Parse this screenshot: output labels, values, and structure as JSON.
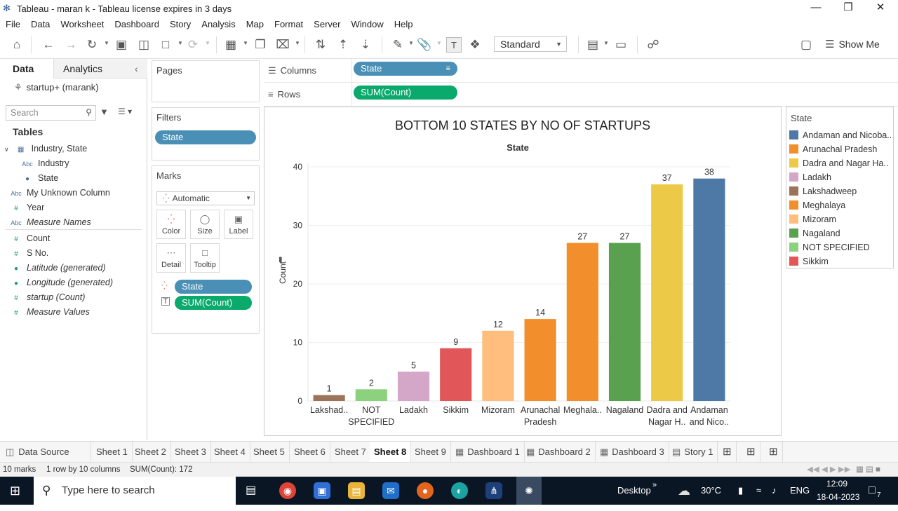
{
  "window": {
    "title": "Tableau - maran k - Tableau license expires in 3 days"
  },
  "menu": [
    "File",
    "Data",
    "Worksheet",
    "Dashboard",
    "Story",
    "Analysis",
    "Map",
    "Format",
    "Server",
    "Window",
    "Help"
  ],
  "toolbar": {
    "fit_value": "Standard",
    "show_me_label": "Show Me"
  },
  "datapane": {
    "tab_data": "Data",
    "tab_analytics": "Analytics",
    "datasource": "startup+ (marank)",
    "search_placeholder": "Search",
    "tables_heading": "Tables",
    "table_group": "Industry, State",
    "fields": [
      {
        "label": "Industry",
        "icon": "abc"
      },
      {
        "label": "State",
        "icon": "globe"
      },
      {
        "label": "My Unknown Column",
        "icon": "abc"
      },
      {
        "label": "Year",
        "icon": "hash"
      },
      {
        "label": "Measure Names",
        "icon": "abc"
      },
      {
        "label": "Count",
        "icon": "hash"
      },
      {
        "label": "S No.",
        "icon": "hash"
      },
      {
        "label": "Latitude (generated)",
        "icon": "globe"
      },
      {
        "label": "Longitude (generated)",
        "icon": "globe"
      },
      {
        "label": "startup (Count)",
        "icon": "hash"
      },
      {
        "label": "Measure Values",
        "icon": "hash"
      }
    ]
  },
  "pages": {
    "title": "Pages"
  },
  "filters": {
    "title": "Filters",
    "pill": "State"
  },
  "marks": {
    "title": "Marks",
    "type": "Automatic",
    "buttons": [
      "Color",
      "Size",
      "Label",
      "Detail",
      "Tooltip"
    ],
    "pill_state": "State",
    "pill_count": "SUM(Count)"
  },
  "shelves": {
    "columns_label": "Columns",
    "columns_pill": "State",
    "rows_label": "Rows",
    "rows_pill": "SUM(Count)"
  },
  "chart_data": {
    "type": "bar",
    "title": "BOTTOM 10 STATES BY NO OF STARTUPS",
    "subtitle": "State",
    "ylabel": "Count",
    "ylim": [
      0,
      40
    ],
    "yticks": [
      0,
      10,
      20,
      30,
      40
    ],
    "grid": true,
    "categories": [
      "Lakshad..",
      "NOT SPECIFIED",
      "Ladakh",
      "Sikkim",
      "Mizoram",
      "Arunachal Pradesh",
      "Meghala..",
      "Nagaland",
      "Dadra and Nagar H..",
      "Andaman and Nico.."
    ],
    "category_lines": [
      [
        "Lakshad.."
      ],
      [
        "NOT",
        "SPECIFIED"
      ],
      [
        "Ladakh"
      ],
      [
        "Sikkim"
      ],
      [
        "Mizoram"
      ],
      [
        "Arunachal",
        "Pradesh"
      ],
      [
        "Meghala.."
      ],
      [
        "Nagaland"
      ],
      [
        "Dadra and",
        "Nagar H.."
      ],
      [
        "Andaman",
        "and Nico.."
      ]
    ],
    "values": [
      1,
      2,
      5,
      9,
      12,
      14,
      27,
      27,
      37,
      38
    ],
    "colors": [
      "#9c7459",
      "#8cd17d",
      "#d4a6c8",
      "#e15759",
      "#ffbe7d",
      "#f28e2b",
      "#f28e2b",
      "#59a14f",
      "#edc948",
      "#4e79a7"
    ]
  },
  "legend": {
    "title": "State",
    "items": [
      {
        "label": "Andaman and Nicoba..",
        "color": "#4e79a7"
      },
      {
        "label": "Arunachal Pradesh",
        "color": "#f28e2b"
      },
      {
        "label": "Dadra and Nagar Ha..",
        "color": "#edc948"
      },
      {
        "label": "Ladakh",
        "color": "#d4a6c8"
      },
      {
        "label": "Lakshadweep",
        "color": "#9c7459"
      },
      {
        "label": "Meghalaya",
        "color": "#f28e2b"
      },
      {
        "label": "Mizoram",
        "color": "#ffbe7d"
      },
      {
        "label": "Nagaland",
        "color": "#59a14f"
      },
      {
        "label": "NOT SPECIFIED",
        "color": "#8cd17d"
      },
      {
        "label": "Sikkim",
        "color": "#e15759"
      }
    ]
  },
  "tabs": [
    {
      "label": "Data Source",
      "icon": "database-icon"
    },
    {
      "label": "Sheet 1"
    },
    {
      "label": "Sheet 2"
    },
    {
      "label": "Sheet 3"
    },
    {
      "label": "Sheet 4"
    },
    {
      "label": "Sheet 5"
    },
    {
      "label": "Sheet 6"
    },
    {
      "label": "Sheet 7"
    },
    {
      "label": "Sheet 8",
      "active": true
    },
    {
      "label": "Sheet 9"
    },
    {
      "label": "Dashboard 1"
    },
    {
      "label": "Dashboard 2"
    },
    {
      "label": "Dashboard 3"
    },
    {
      "label": "Story 1"
    }
  ],
  "status": {
    "marks": "10 marks",
    "rows_cols": "1 row by 10 columns",
    "sum": "SUM(Count): 172"
  },
  "taskbar": {
    "search_placeholder": "Type here to search",
    "desktop_label": "Desktop",
    "weather": "30°C",
    "lang": "ENG",
    "time": "12:09",
    "date": "18-04-2023",
    "notifications": "7"
  }
}
